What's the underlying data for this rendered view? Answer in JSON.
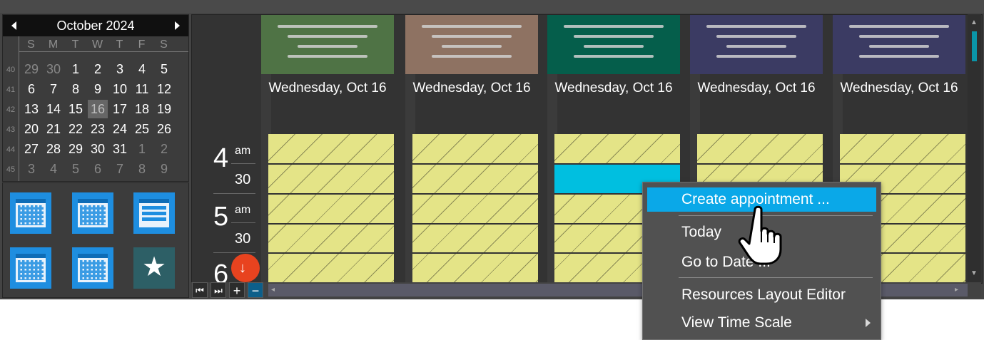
{
  "mini_calendar": {
    "title": "October 2024",
    "weekday_headers": [
      "S",
      "M",
      "T",
      "W",
      "T",
      "F",
      "S"
    ],
    "week_numbers": [
      "40",
      "41",
      "42",
      "43",
      "44",
      "45"
    ],
    "weeks": [
      [
        "29",
        "30",
        "1",
        "2",
        "3",
        "4",
        "5"
      ],
      [
        "6",
        "7",
        "8",
        "9",
        "10",
        "11",
        "12"
      ],
      [
        "13",
        "14",
        "15",
        "16",
        "17",
        "18",
        "19"
      ],
      [
        "20",
        "21",
        "22",
        "23",
        "24",
        "25",
        "26"
      ],
      [
        "27",
        "28",
        "29",
        "30",
        "31",
        "1",
        "2"
      ],
      [
        "3",
        "4",
        "5",
        "6",
        "7",
        "8",
        "9"
      ]
    ],
    "selected_day": "16"
  },
  "view_buttons": [
    "day-view-icon",
    "work-week-view-icon",
    "timeline-view-icon",
    "week-view-icon",
    "month-view-icon",
    "favorites-star-icon"
  ],
  "time_ruler": {
    "hours": [
      {
        "hour": "4",
        "ampm": "am"
      },
      {
        "hour": "5",
        "ampm": "am"
      },
      {
        "hour": "6",
        "ampm": ""
      }
    ],
    "half_label": "30"
  },
  "resources": [
    {
      "date": "Wednesday, Oct 16",
      "color": "#4f7345"
    },
    {
      "date": "Wednesday, Oct 16",
      "color": "#8e7262"
    },
    {
      "date": "Wednesday, Oct 16",
      "color": "#055e4b"
    },
    {
      "date": "Wednesday, Oct 16",
      "color": "#3b3b63"
    },
    {
      "date": "Wednesday, Oct 16",
      "color": "#3b3b63"
    }
  ],
  "appointment": {
    "color": "#00bfe0"
  },
  "bottom_buttons": [
    "skip-first-icon",
    "skip-last-icon",
    "zoom-in-icon",
    "zoom-out-icon"
  ],
  "context_menu": {
    "items": [
      {
        "label": "Create appointment ...",
        "highlighted": true
      },
      {
        "label": "Today",
        "highlighted": false
      },
      {
        "label": "Go to Date ...",
        "highlighted": false
      },
      {
        "label": "Resources Layout Editor",
        "highlighted": false
      },
      {
        "label": "View Time Scale",
        "highlighted": false,
        "submenu": true
      }
    ]
  },
  "colors": {
    "accent": "#0aa8e8",
    "cell": "#e4e487",
    "fab": "#e8431f"
  }
}
